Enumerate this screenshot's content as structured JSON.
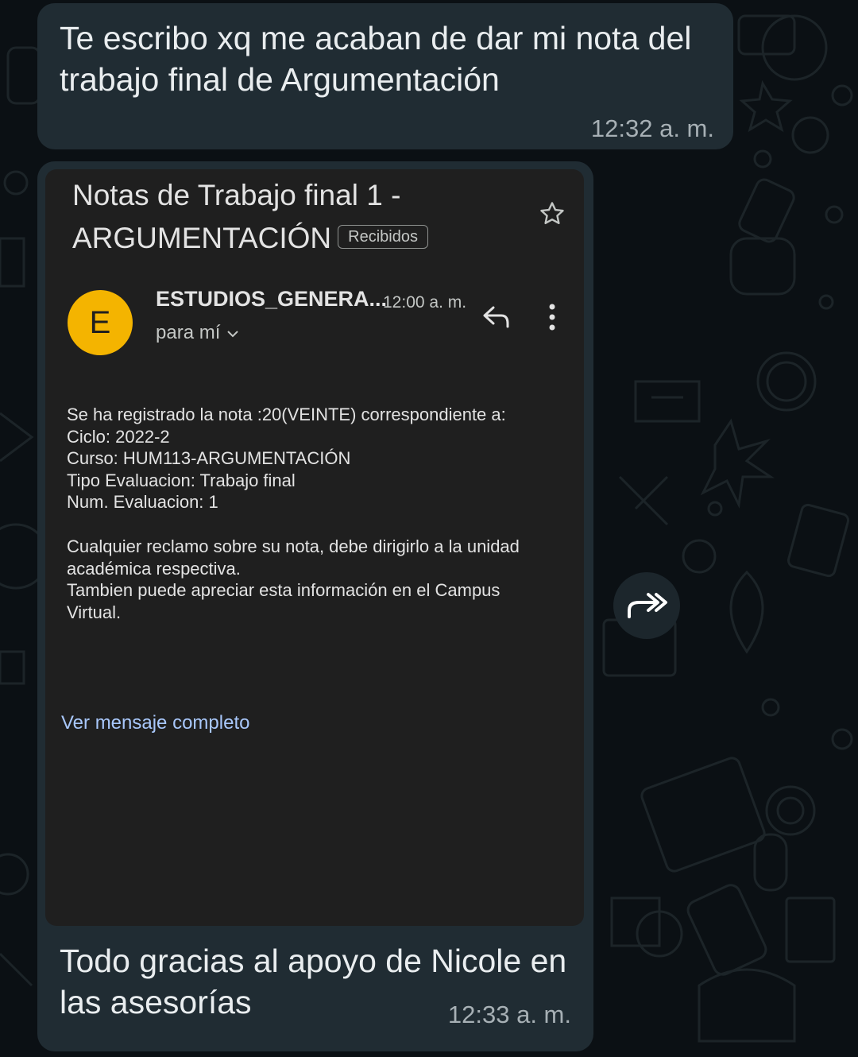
{
  "chat": {
    "messages": [
      {
        "text": "Te escribo xq me acaban de dar mi nota del trabajo final de Argumentación",
        "time": "12:32 a. m."
      },
      {
        "email": {
          "subject": "Notas de Trabajo final 1 - ARGUMENTACIÓN",
          "label": "Recibidos",
          "sender_initial": "E",
          "sender": "ESTUDIOS_GENERA...",
          "sent_time": "12:00 a. m.",
          "recipient": "para mí",
          "body_lines": [
            "Se ha registrado la nota :20(VEINTE) correspondiente a:",
            "Ciclo: 2022-2",
            "Curso: HUM113-ARGUMENTACIÓN",
            "Tipo Evaluacion: Trabajo final",
            "Num. Evaluacion: 1"
          ],
          "body_paragraph2": [
            "Cualquier reclamo sobre su nota, debe dirigirlo a la unidad",
            "académica respectiva.",
            "Tambien puede apreciar esta información en el Campus",
            "Virtual."
          ],
          "view_full_link": "Ver mensaje completo"
        },
        "caption": "Todo gracias al apoyo de Nicole en las asesorías",
        "time": "12:33 a. m."
      }
    ]
  },
  "colors": {
    "background": "#0b1014",
    "bubble": "#202c33",
    "email_card": "#1f1f1f",
    "avatar": "#f4b400",
    "link": "#a8c7fa"
  },
  "icons": [
    "star-icon",
    "reply-icon",
    "more-vert-icon",
    "chevron-down-icon",
    "forward-icon"
  ]
}
